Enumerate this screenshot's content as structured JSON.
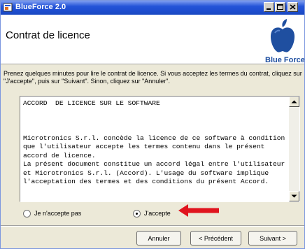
{
  "window": {
    "title": "BlueForce 2.0",
    "controls": {
      "minimize": "minimize-icon",
      "maximize": "maximize-icon",
      "close": "close-icon"
    }
  },
  "header": {
    "title": "Contrat de licence",
    "logo_text": "Blue Force",
    "logo_icon": "apple-icon"
  },
  "instructions": "Prenez quelques minutes pour lire le contrat de licence. Si vous acceptez les termes du contrat, cliquez sur \"J'accepte\", puis sur \"Suivant\". Sinon, cliquez sur \"Annuler\".",
  "license": {
    "heading": "ACCORD  DE LICENCE SUR LE SOFTWARE",
    "paragraphs": [
      "Microtronics S.r.l. concède la licence de ce software à condition que l'utilisateur accepte les termes contenu dans le présent accord de licence.",
      "La présent document constitue un accord légal entre l'utilisateur et Microtronics S.r.l. (Accord). L'usage du software implique l'acceptation des termes et des conditions du présent Accord."
    ]
  },
  "radios": {
    "decline": {
      "label": "Je n'accepte pas",
      "checked": false
    },
    "accept": {
      "label": "J'accepte",
      "checked": true
    }
  },
  "buttons": {
    "cancel": "Annuler",
    "back": "< Précédent",
    "next": "Suivant >"
  },
  "colors": {
    "titlebar": "#2454d8",
    "logo_blue": "#1f4fa0",
    "arrow_red": "#e0141e"
  }
}
